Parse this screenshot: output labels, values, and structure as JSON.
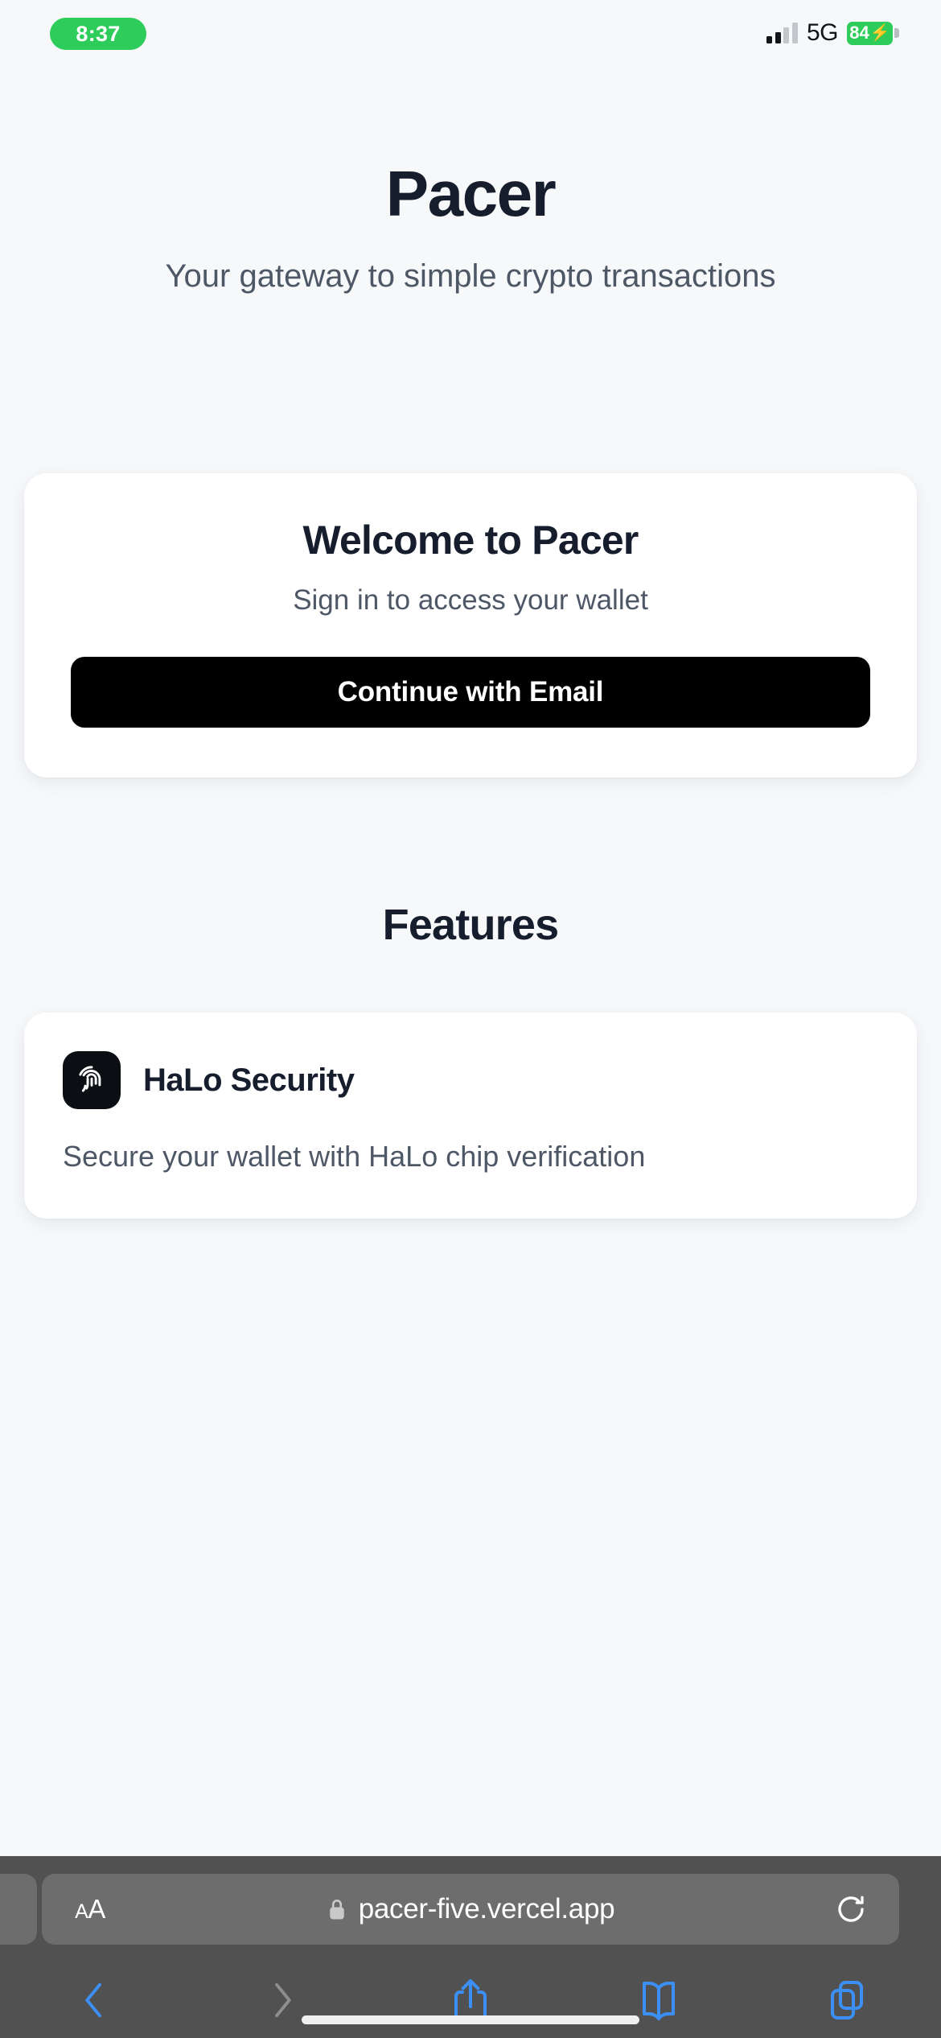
{
  "status_bar": {
    "time": "8:37",
    "network_type": "5G",
    "battery_percent": "84",
    "battery_charging_icon": "bolt-icon",
    "signal_icon": "cellular-signal-icon",
    "time_pill_color": "#2ecc5a",
    "battery_color": "#2ecc5a"
  },
  "page": {
    "background_color": "#f6f8fa",
    "hero": {
      "title": "Pacer",
      "subtitle": "Your gateway to simple crypto transactions"
    },
    "welcome_card": {
      "title": "Welcome to Pacer",
      "subtitle": "Sign in to access your wallet",
      "primary_button": {
        "label": "Continue with Email",
        "background_color": "#000000",
        "text_color": "#ffffff"
      }
    },
    "features_section": {
      "heading": "Features",
      "items": [
        {
          "icon": "fingerprint-icon",
          "icon_background": "#0b0e12",
          "title": "HaLo Security",
          "description": "Secure your wallet with HaLo chip verification"
        }
      ]
    },
    "text_colors": {
      "heading": "#161d2d",
      "body": "#4d5766"
    }
  },
  "browser": {
    "chrome_color": "#515151",
    "url_bar": {
      "background_color": "#6d6d6d",
      "text_size_label_small": "A",
      "text_size_label_large": "A",
      "text_size_button_name": "text-size-button",
      "lock_icon": "lock-icon",
      "url": "pacer-five.vercel.app",
      "reload_icon": "reload-icon"
    },
    "toolbar": {
      "accent_color": "#3c90f5",
      "disabled_color": "#8e8e8e",
      "items": [
        {
          "name": "back-button",
          "icon": "chevron-left-icon",
          "enabled": true
        },
        {
          "name": "forward-button",
          "icon": "chevron-right-icon",
          "enabled": false
        },
        {
          "name": "share-button",
          "icon": "share-icon",
          "enabled": true
        },
        {
          "name": "bookmarks-button",
          "icon": "book-icon",
          "enabled": true
        },
        {
          "name": "tabs-button",
          "icon": "tabs-icon",
          "enabled": true
        }
      ]
    }
  }
}
